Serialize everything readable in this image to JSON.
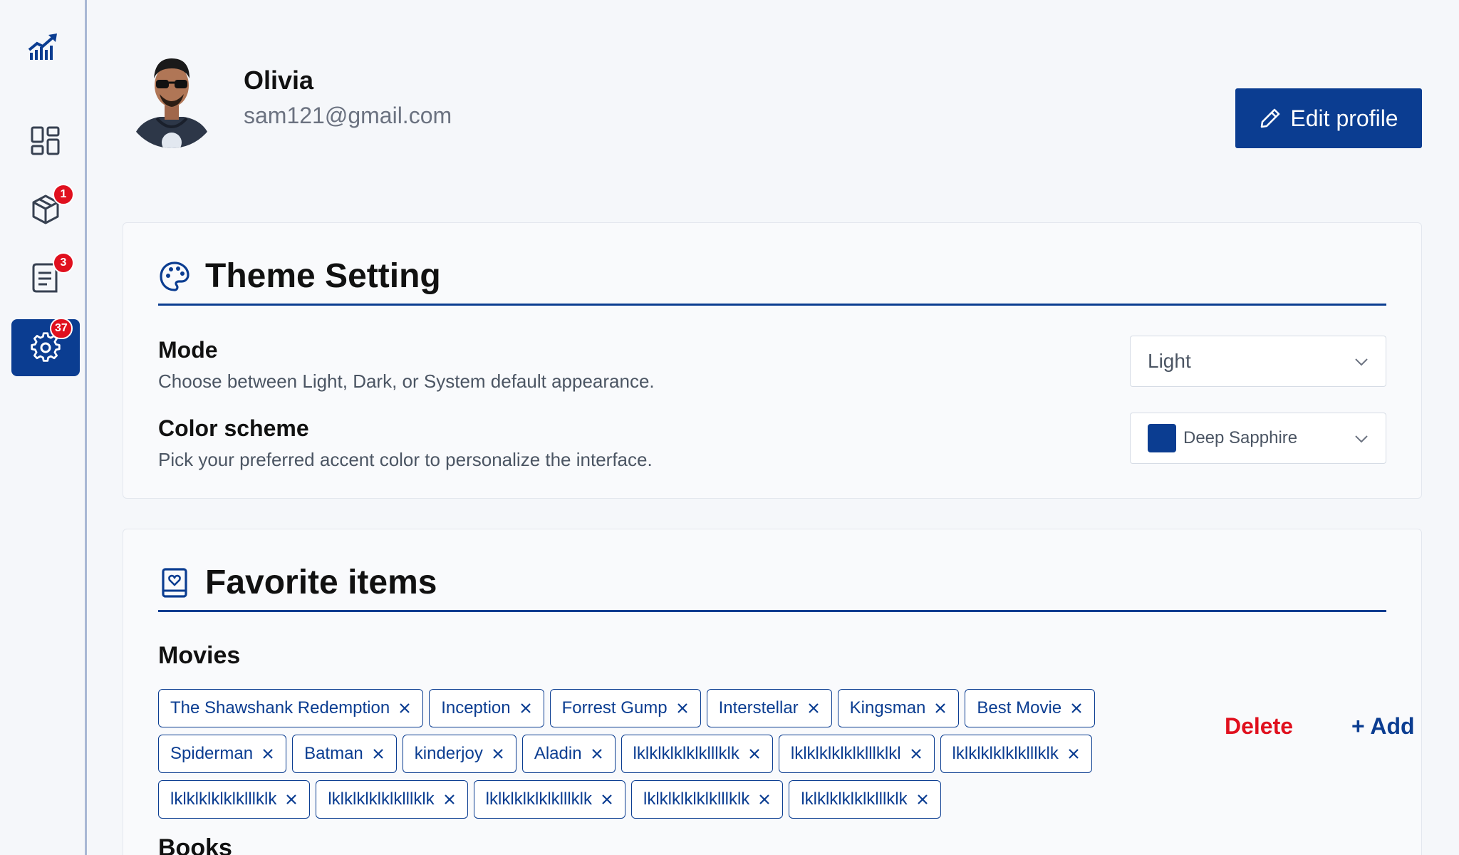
{
  "sidebar": {
    "items": [
      {
        "name": "dashboard",
        "badge": ""
      },
      {
        "name": "packages",
        "badge": "1"
      },
      {
        "name": "documents",
        "badge": "3"
      },
      {
        "name": "settings",
        "badge": "37"
      }
    ]
  },
  "profile": {
    "name": "Olivia",
    "email": "sam121@gmail.com",
    "edit_label": "Edit profile"
  },
  "theme": {
    "title": "Theme Setting",
    "mode_label": "Mode",
    "mode_desc": "Choose between Light, Dark, or System default appearance.",
    "mode_value": "Light",
    "color_label": "Color scheme",
    "color_desc": "Pick your preferred accent color to personalize the interface.",
    "color_value": "Deep Sapphire",
    "color_hex": "#0b3d91"
  },
  "favorites": {
    "title": "Favorite items",
    "movies_label": "Movies",
    "movies_rows": [
      [
        "The Shawshank Redemption",
        "Inception",
        "Forrest Gump",
        "Interstellar",
        "Kingsman",
        "Best Movie"
      ],
      [
        "Spiderman",
        "Batman",
        "kinderjoy",
        "Aladin",
        "lklklklklklklllklk",
        "lklklklklklklllklkl",
        "lklklklklklklllklk"
      ],
      [
        "lklklklklklklllklk",
        "lklklklklklklllklk",
        "lklklklklklklllklk",
        "lklklklklklklllklk",
        "lklklklklklklllklk"
      ]
    ],
    "delete_label": "Delete",
    "add_label": "+ Add",
    "books_label": "Books"
  },
  "colors": {
    "accent": "#0b3d91",
    "danger": "#e0101e"
  }
}
